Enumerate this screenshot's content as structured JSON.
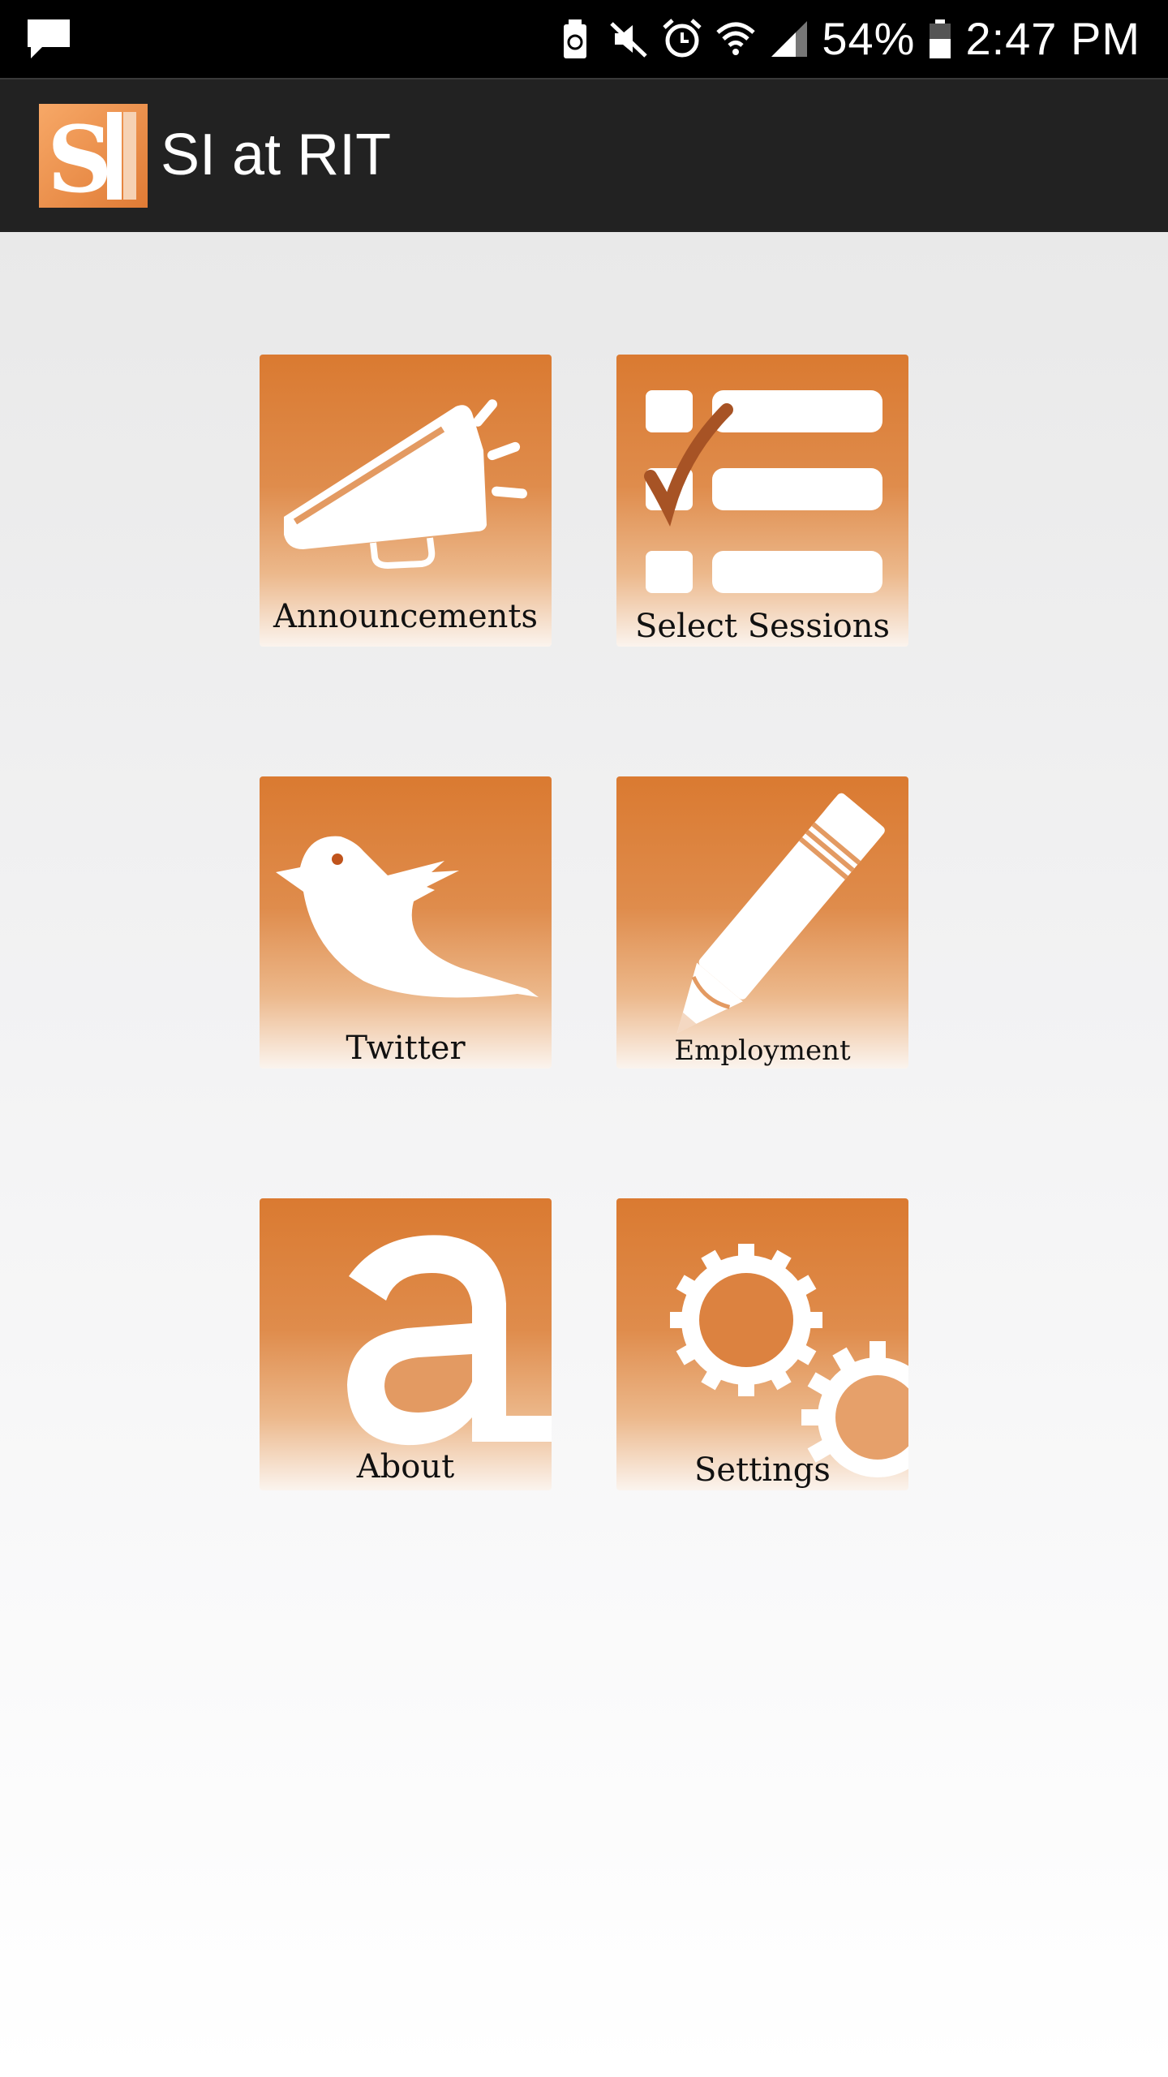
{
  "status_bar": {
    "battery_percent": "54%",
    "time": "2:47 PM",
    "icons": [
      "chat-notification-icon",
      "battery-saver-icon",
      "mute-icon",
      "alarm-icon",
      "wifi-icon",
      "signal-icon",
      "battery-icon"
    ]
  },
  "action_bar": {
    "title": "SI at RIT",
    "logo_icon": "si-logo-icon"
  },
  "menu": {
    "tiles": [
      {
        "label": "Announcements",
        "icon": "megaphone-icon"
      },
      {
        "label": "Select Sessions",
        "icon": "checklist-icon"
      },
      {
        "label": "Twitter",
        "icon": "bird-icon"
      },
      {
        "label": "Employment",
        "icon": "pencil-icon"
      },
      {
        "label": "About",
        "icon": "letter-a-icon"
      },
      {
        "label": "Settings",
        "icon": "gears-icon"
      }
    ]
  },
  "colors": {
    "accent": "#da7a31",
    "status_bar_bg": "#000000",
    "action_bar_bg": "#222222"
  }
}
